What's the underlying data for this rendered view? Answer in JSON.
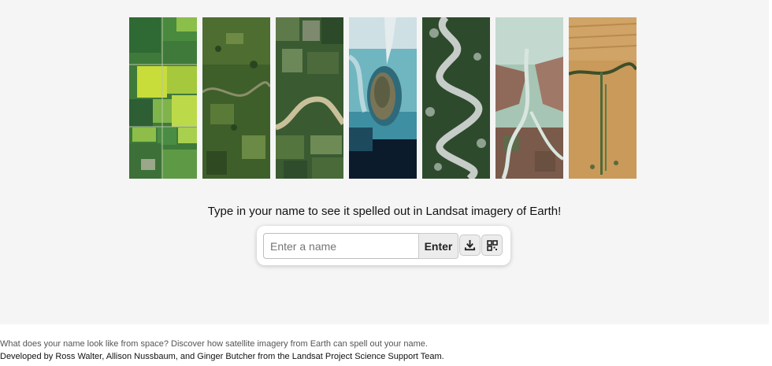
{
  "hero": {
    "tiles": [
      {
        "name": "farmland-fields"
      },
      {
        "name": "forest-river"
      },
      {
        "name": "river-bend"
      },
      {
        "name": "coastal-island"
      },
      {
        "name": "meandering-river"
      },
      {
        "name": "river-delta"
      },
      {
        "name": "desert-dunes"
      }
    ],
    "prompt": "Type in your name to see it spelled out in Landsat imagery of Earth!"
  },
  "form": {
    "input_placeholder": "Enter a name",
    "input_value": "",
    "enter_label": "Enter",
    "download_icon": "download-icon",
    "qr_icon": "qr-code-icon"
  },
  "footer": {
    "description": "What does your name look like from space? Discover how satellite imagery from Earth can spell out your name.",
    "credit": "Developed by Ross Walter, Allison Nussbaum, and Ginger Butcher from the Landsat Project Science Support Team."
  },
  "colors": {
    "hero_bg": "#f5f5f5",
    "button_bg": "#ececec"
  }
}
